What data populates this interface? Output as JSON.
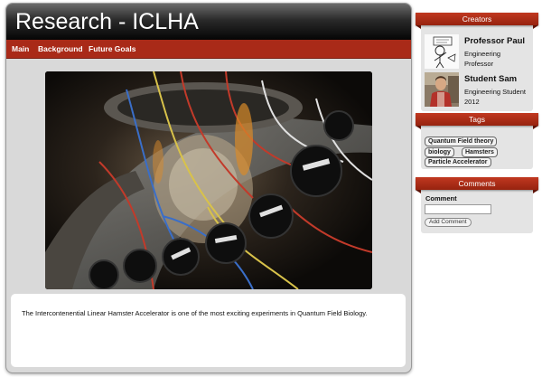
{
  "site": {
    "title": "Research - ICLHA"
  },
  "nav": {
    "items": [
      {
        "label": "Main"
      },
      {
        "label": "Background"
      },
      {
        "label": "Future Goals"
      }
    ]
  },
  "main": {
    "photo_alt": "Accelerator apparatus with cables and detectors",
    "caption": "The Intercontenential Linear Hamster Accelerator is one of the most exciting experiments in Quantum Field Biology."
  },
  "creators": {
    "title": "Creators",
    "people": [
      {
        "name": "Professor Paul",
        "role": "Engineering Professor",
        "avatar_icon": "cartoon-professor-avatar"
      },
      {
        "name": "Student Sam",
        "role": "Engineering Student 2012",
        "avatar_icon": "student-photo-avatar"
      }
    ]
  },
  "tags": {
    "title": "Tags",
    "items": [
      {
        "label": "Quantum Field theory"
      },
      {
        "label": "biology"
      },
      {
        "label": "Hamsters"
      },
      {
        "label": "Particle Accelerator"
      }
    ]
  },
  "comments": {
    "title": "Comments",
    "field_label": "Comment",
    "input_value": "",
    "button_label": "Add Comment"
  },
  "colors": {
    "accent_red": "#a92a18",
    "header_dark": "#050505",
    "panel_gray": "#d9d9d9"
  }
}
